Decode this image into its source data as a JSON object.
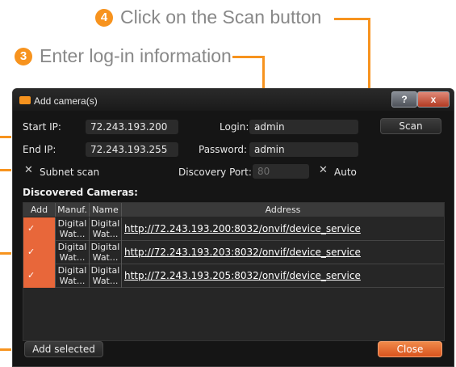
{
  "annotations": [
    {
      "number": "4",
      "text": "Click on the Scan button"
    },
    {
      "number": "3",
      "text": "Enter log-in information"
    }
  ],
  "window": {
    "title": "Add camera(s)",
    "help_label": "?",
    "close_label": "x"
  },
  "form": {
    "start_ip_label": "Start IP:",
    "start_ip_value": "72.243.193.200",
    "end_ip_label": "End IP:",
    "end_ip_value": "72.243.193.255",
    "login_label": "Login:",
    "login_value": "admin",
    "password_label": "Password:",
    "password_value": "admin",
    "discovery_port_label": "Discovery Port:",
    "discovery_port_value": "80",
    "subnet_scan_label": "Subnet scan",
    "auto_label": "Auto",
    "scan_label": "Scan"
  },
  "discovered": {
    "heading": "Discovered Cameras:",
    "columns": [
      "Add",
      "Manuf.",
      "Name",
      "Address"
    ],
    "rows": [
      {
        "manuf": "Digital Wat...",
        "name": "Digital Wat...",
        "address": "http://72.243.193.200:8032/onvif/device_service"
      },
      {
        "manuf": "Digital Wat...",
        "name": "Digital Wat...",
        "address": "http://72.243.193.203:8032/onvif/device_service"
      },
      {
        "manuf": "Digital Wat...",
        "name": "Digital Wat...",
        "address": "http://72.243.193.205:8032/onvif/device_service"
      }
    ]
  },
  "footer": {
    "add_selected_label": "Add selected",
    "close_label": "Close"
  },
  "colors": {
    "accent": "#f7931e",
    "check_bg": "#e8673a",
    "window_bg": "#151515"
  }
}
